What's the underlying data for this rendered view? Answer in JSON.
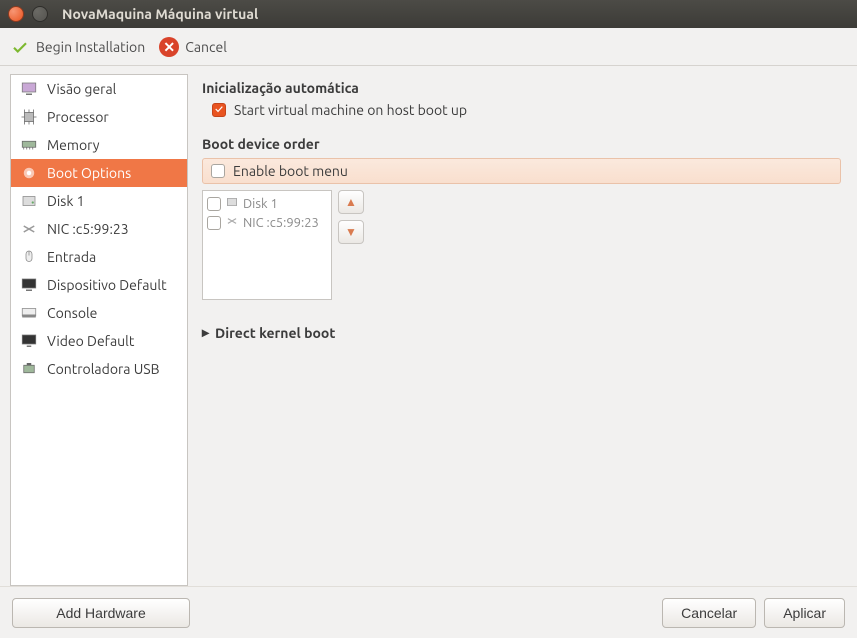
{
  "window": {
    "title": "NovaMaquina Máquina virtual"
  },
  "toolbar": {
    "begin": "Begin Installation",
    "cancel": "Cancel"
  },
  "sidebar": {
    "items": [
      {
        "label": "Visão geral"
      },
      {
        "label": "Processor"
      },
      {
        "label": "Memory"
      },
      {
        "label": "Boot Options"
      },
      {
        "label": "Disk 1"
      },
      {
        "label": "NIC :c5:99:23"
      },
      {
        "label": "Entrada"
      },
      {
        "label": "Dispositivo Default"
      },
      {
        "label": "Console"
      },
      {
        "label": "Video Default"
      },
      {
        "label": "Controladora USB"
      }
    ],
    "add_hw": "Add Hardware"
  },
  "content": {
    "autostart_title": "Inicialização automática",
    "autostart_label": "Start virtual machine on host boot up",
    "boot_order_title": "Boot device order",
    "enable_boot_menu": "Enable boot menu",
    "boot_items": [
      {
        "label": "Disk 1"
      },
      {
        "label": "NIC :c5:99:23"
      }
    ],
    "direct_kernel": "Direct kernel boot"
  },
  "footer": {
    "cancel": "Cancelar",
    "apply": "Aplicar"
  }
}
